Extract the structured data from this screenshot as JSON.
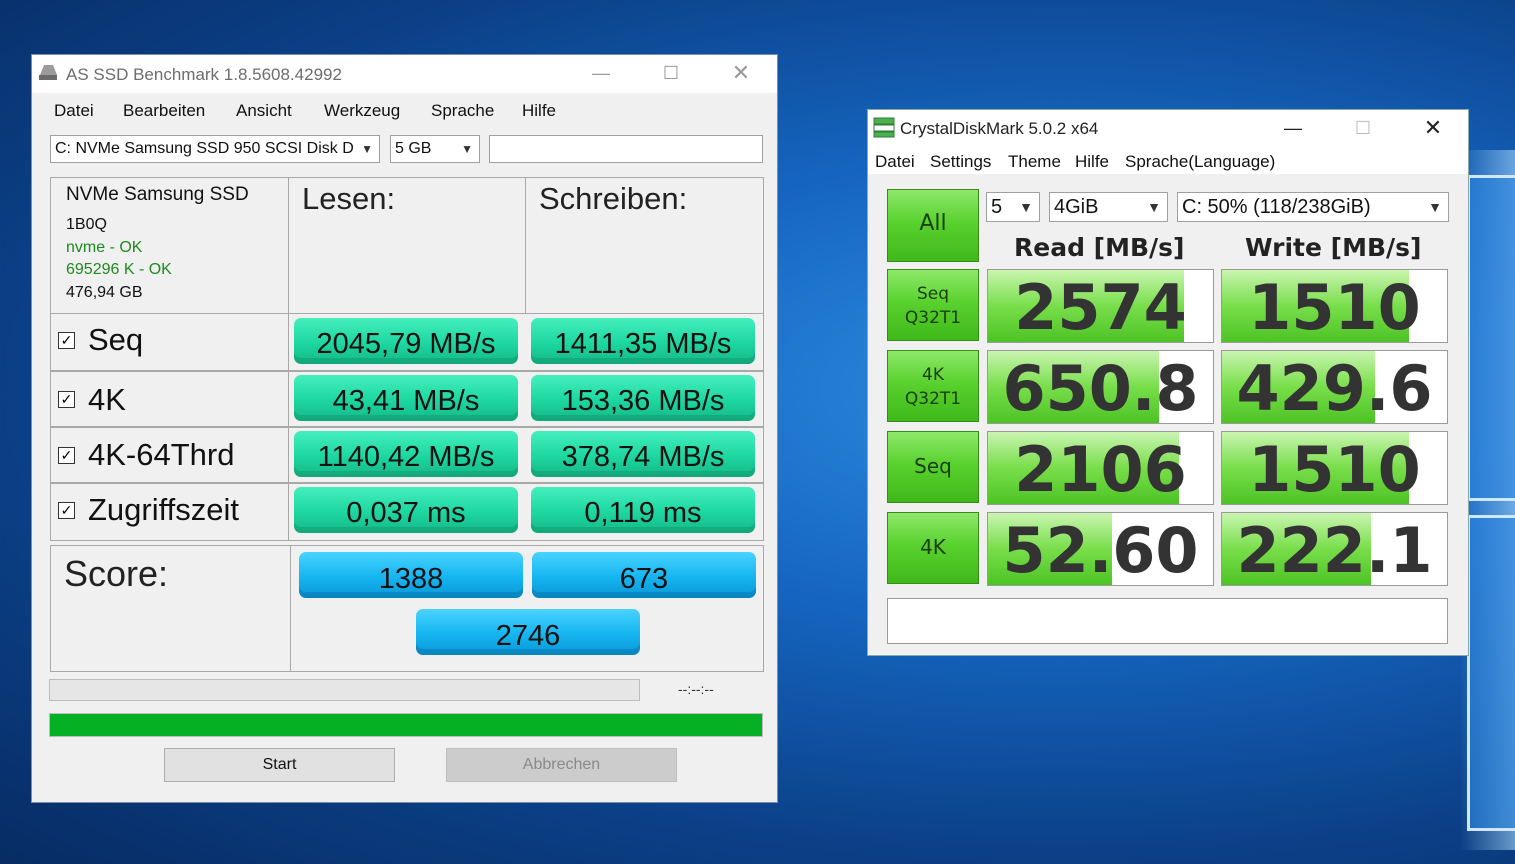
{
  "asssd": {
    "title": "AS SSD Benchmark 1.8.5608.42992",
    "menu": [
      "Datei",
      "Bearbeiten",
      "Ansicht",
      "Werkzeug",
      "Sprache",
      "Hilfe"
    ],
    "drive_select": "C: NVMe Samsung SSD 950 SCSI Disk D",
    "size_select": "5 GB",
    "drive_info": {
      "name": "NVMe Samsung SSD",
      "firmware": "1B0Q",
      "driver_status": "nvme - OK",
      "alignment_status": "695296 K - OK",
      "capacity": "476,94 GB"
    },
    "header_read": "Lesen:",
    "header_write": "Schreiben:",
    "rows": [
      {
        "label": "Seq",
        "read": "2045,79 MB/s",
        "write": "1411,35 MB/s"
      },
      {
        "label": "4K",
        "read": "43,41 MB/s",
        "write": "153,36 MB/s"
      },
      {
        "label": "4K-64Thrd",
        "read": "1140,42 MB/s",
        "write": "378,74 MB/s"
      },
      {
        "label": "Zugriffszeit",
        "read": "0,037 ms",
        "write": "0,119 ms"
      }
    ],
    "score_label": "Score:",
    "score_read": "1388",
    "score_write": "673",
    "score_total": "2746",
    "time_display": "--:--:--",
    "progress": 1.0,
    "start_label": "Start",
    "cancel_label": "Abbrechen",
    "colors": {
      "value_green": "#1dd7a0",
      "score_blue": "#15b5f0",
      "progress_green": "#06b025"
    }
  },
  "cdm": {
    "title": "CrystalDiskMark 5.0.2 x64",
    "menu": [
      "Datei",
      "Settings",
      "Theme",
      "Hilfe",
      "Sprache(Language)"
    ],
    "count_select": "5",
    "size_select": "4GiB",
    "drive_select": "C: 50% (118/238GiB)",
    "all_label": "All",
    "header_read": "Read [MB/s]",
    "header_write": "Write [MB/s]",
    "rows": [
      {
        "label_line1": "Seq",
        "label_line2": "Q32T1",
        "read": "2574",
        "write": "1510",
        "read_fill": 0.87,
        "write_fill": 0.83
      },
      {
        "label_line1": "4K",
        "label_line2": "Q32T1",
        "read": "650.8",
        "write": "429.6",
        "read_fill": 0.76,
        "write_fill": 0.68
      },
      {
        "label_line1": "Seq",
        "label_line2": "",
        "read": "2106",
        "write": "1510",
        "read_fill": 0.85,
        "write_fill": 0.83
      },
      {
        "label_line1": "4K",
        "label_line2": "",
        "read": "52.60",
        "write": "222.1",
        "read_fill": 0.55,
        "write_fill": 0.66
      }
    ],
    "comment": ""
  }
}
